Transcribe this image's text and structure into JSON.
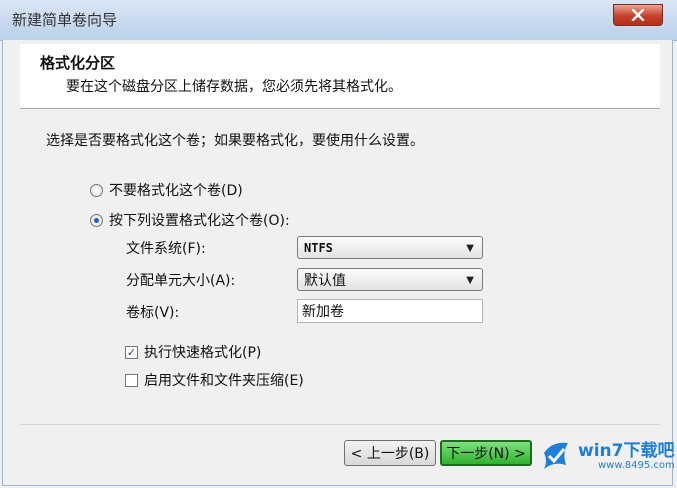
{
  "window": {
    "title": "新建简单卷向导",
    "close_icon": "close-icon"
  },
  "header": {
    "title": "格式化分区",
    "subtitle": "要在这个磁盘分区上储存数据，您必须先将其格式化。"
  },
  "content": {
    "prompt": "选择是否要格式化这个卷；如果要格式化，要使用什么设置。",
    "options": [
      {
        "label": "不要格式化这个卷(D)",
        "checked": false
      },
      {
        "label": "按下列设置格式化这个卷(O):",
        "checked": true
      }
    ],
    "file_system": {
      "label": "文件系统(F):",
      "value": "NTFS"
    },
    "allocation_unit": {
      "label": "分配单元大小(A):",
      "value": "默认值"
    },
    "volume_label": {
      "label": "卷标(V):",
      "value": "新加卷"
    },
    "checkboxes": [
      {
        "label": "执行快速格式化(P)",
        "checked": true
      },
      {
        "label": "启用文件和文件夹压缩(E)",
        "checked": false
      }
    ]
  },
  "buttons": {
    "back": "< 上一步(B)",
    "next": "下一步(N) >"
  },
  "watermark": {
    "brand": "win7下载吧",
    "url": "www.8495.com"
  },
  "colors": {
    "accent_green": "#2fb22f",
    "brand_blue": "#1e7fd8",
    "close_red": "#c7402a"
  }
}
